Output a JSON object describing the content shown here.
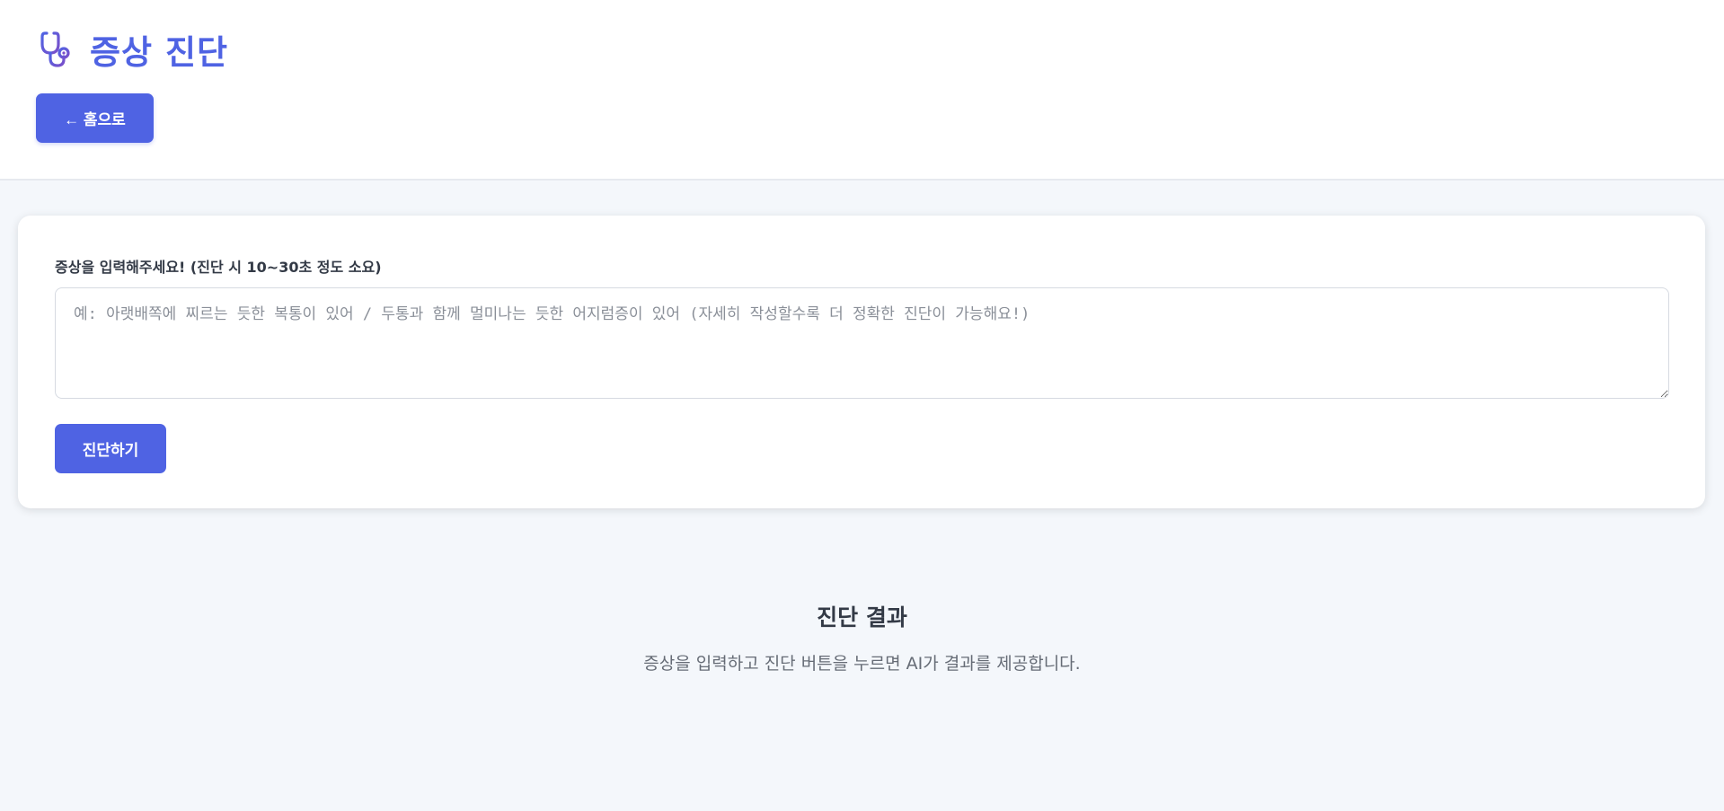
{
  "header": {
    "title": "증상 진단",
    "title_icon": "stethoscope-icon",
    "home_button_label": "← 홈으로"
  },
  "form": {
    "label": "증상을 입력해주세요! (진단 시 10~30초 정도 소요)",
    "input_value": "",
    "input_placeholder": "예: 아랫배쪽에 찌르는 듯한 복통이 있어 / 두통과 함께 멀미나는 듯한 어지럼증이 있어 (자세히 작성할수록 더 정확한 진단이 가능해요!)",
    "submit_label": "진단하기"
  },
  "result": {
    "title": "진단 결과",
    "description": "증상을 입력하고 진단 버튼을 누르면 AI가 결과를 제공합니다."
  },
  "colors": {
    "accent": "#4f63e3",
    "background": "#f4f7fb",
    "card": "#ffffff"
  }
}
